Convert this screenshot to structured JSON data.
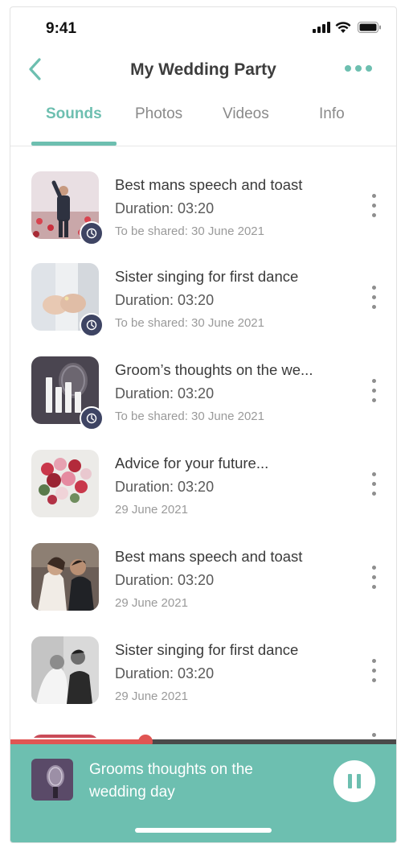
{
  "status_bar": {
    "time": "9:41"
  },
  "header": {
    "title": "My Wedding Party"
  },
  "tabs": [
    {
      "label": "Sounds",
      "active": true
    },
    {
      "label": "Photos",
      "active": false
    },
    {
      "label": "Videos",
      "active": false
    },
    {
      "label": "Info",
      "active": false
    }
  ],
  "items": [
    {
      "title": "Best mans speech and toast",
      "duration": "Duration: 03:20",
      "date": "To be shared: 30 June 2021",
      "scheduled": true,
      "thumb": "groom-on-field"
    },
    {
      "title": "Sister singing for first dance",
      "duration": "Duration: 03:20",
      "date": "To be shared: 30 June 2021",
      "scheduled": true,
      "thumb": "holding-hands"
    },
    {
      "title": "Groom’s thoughts on the we...",
      "duration": "Duration: 03:20",
      "date": "To be shared: 30 June 2021",
      "scheduled": true,
      "thumb": "microphone-waveform"
    },
    {
      "title": "Advice for your future...",
      "duration": "Duration: 03:20",
      "date": "29 June 2021",
      "scheduled": false,
      "thumb": "bouquet"
    },
    {
      "title": "Best mans speech and toast",
      "duration": "Duration: 03:20",
      "date": "29 June 2021",
      "scheduled": false,
      "thumb": "couple-embrace"
    },
    {
      "title": "Sister singing for first dance",
      "duration": "Duration: 03:20",
      "date": "29 June 2021",
      "scheduled": false,
      "thumb": "couple-bw"
    }
  ],
  "player": {
    "title": "Grooms thoughts on the wedding day",
    "progress": 0.35,
    "thumb": "microphone"
  },
  "colors": {
    "accent": "#6dbfb0",
    "progress": "#e05553",
    "badge": "#3e4463"
  }
}
